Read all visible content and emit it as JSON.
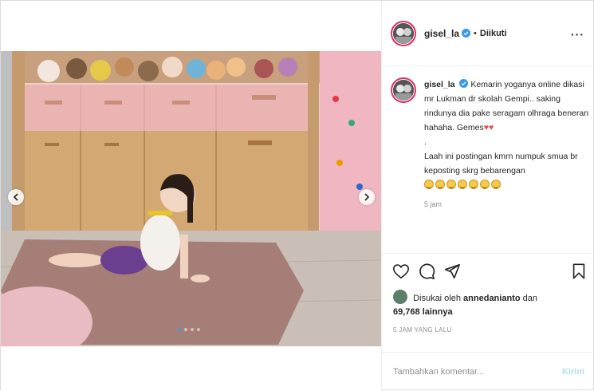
{
  "post": {
    "username": "gisel_la",
    "separator": "•",
    "follow_status": "Diikuti",
    "more_icon": "more-options-icon",
    "caption": {
      "username": "gisel_la",
      "line1": "Kemarin yoganya online dikasi mr Lukman dr skolah Gempi.. saking rindunya dia pake seragam olhraga beneran hahaha. Gemes",
      "hearts": "♥♥",
      "dot": ".",
      "line2": "Laah ini postingan kmrn numpuk smua br keposting skrg bebarengan",
      "emoji_count": 7,
      "time": "5 jam"
    },
    "likes": {
      "prefix": "Disukai oleh",
      "user": "annedanianto",
      "connector": "dan",
      "others": "69,768 lainnya"
    },
    "posted_ago": "5 JAM YANG LALU",
    "comment": {
      "placeholder": "Tambahkan komentar...",
      "post_label": "Kirim"
    },
    "carousel": {
      "slide_count": 4,
      "active_index": 0
    }
  },
  "colors": {
    "accent": "#3897f0",
    "heart": "#ed4956",
    "post_disabled": "#b2dffc",
    "muted": "#8e8e8e"
  }
}
